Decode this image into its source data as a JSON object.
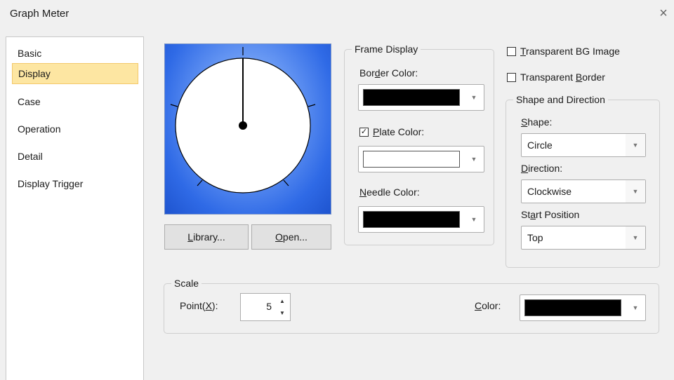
{
  "window": {
    "title": "Graph Meter",
    "close_glyph": "×"
  },
  "sidebar": {
    "items": [
      {
        "label": "Basic"
      },
      {
        "label": "Display",
        "selected": true
      },
      {
        "label": "Case"
      },
      {
        "label": "Operation"
      },
      {
        "label": "Detail"
      },
      {
        "label": "Display Trigger"
      }
    ]
  },
  "preview": {
    "library_button": {
      "pre": "",
      "u": "L",
      "post": "ibrary..."
    },
    "open_button": {
      "pre": "",
      "u": "O",
      "post": "pen..."
    }
  },
  "frame_display": {
    "legend": "Frame Display",
    "border_color": {
      "pre": "Bor",
      "u": "d",
      "post": "er Color:",
      "color": "#000000"
    },
    "plate_color": {
      "pre": "",
      "u": "P",
      "post": "late Color:",
      "checked": true,
      "color": "#ffffff"
    },
    "needle_color": {
      "pre": "",
      "u": "N",
      "post": "eedle Color:",
      "color": "#000000"
    }
  },
  "options": {
    "transparent_bg": {
      "pre": "",
      "u": "T",
      "post": "ransparent BG Image",
      "checked": false
    },
    "transparent_border": {
      "pre": "Transparent ",
      "u": "B",
      "post": "order",
      "checked": false
    }
  },
  "shape_direction": {
    "legend": "Shape and Direction",
    "shape": {
      "pre": "",
      "u": "S",
      "post": "hape:",
      "value": "Circle"
    },
    "direction": {
      "pre": "",
      "u": "D",
      "post": "irection:",
      "value": "Clockwise"
    },
    "start_position": {
      "pre": "St",
      "u": "a",
      "post": "rt Position",
      "value": "Top"
    }
  },
  "scale": {
    "legend": "Scale",
    "point": {
      "pre": "Point(",
      "u": "X",
      "post": "):",
      "value": "5"
    },
    "color": {
      "pre": "",
      "u": "C",
      "post": "olor:",
      "value": "#000000"
    }
  },
  "colors": {
    "accent_selected": "#fde6a2",
    "preview_blue": "#2f6ae6"
  },
  "icons": [
    "close-icon",
    "dropdown-arrow-icon",
    "spin-up-icon",
    "spin-down-icon",
    "checkbox-icon"
  ]
}
